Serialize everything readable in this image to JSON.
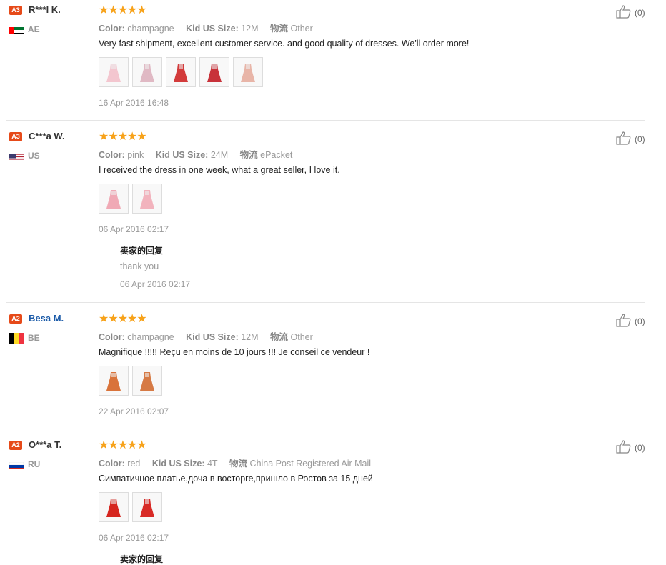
{
  "reviews": [
    {
      "level": "A3",
      "name": "R***l K.",
      "country": "AE",
      "flag": "ae",
      "name_link": false,
      "rating": "★★★★★",
      "color_label": "Color:",
      "color": "champagne",
      "size_label": "Kid US Size:",
      "size": "12M",
      "ship_label": "物流",
      "ship": "Other",
      "text": "Very fast shipment, excellent customer service. and good quality of dresses. We'll order more!",
      "photos": [
        "#f3c6cf",
        "#e0b9c4",
        "#d33b3b",
        "#c8323a",
        "#e8b5a8"
      ],
      "date": "16 Apr 2016 16:48",
      "likes": "(0)"
    },
    {
      "level": "A3",
      "name": "C***a W.",
      "country": "US",
      "flag": "us",
      "name_link": false,
      "rating": "★★★★★",
      "color_label": "Color:",
      "color": "pink",
      "size_label": "Kid US Size:",
      "size": "24M",
      "ship_label": "物流",
      "ship": "ePacket",
      "text": "I received the dress in one week, what a great seller, I love it.",
      "photos": [
        "#f0a9b5",
        "#f2b3bd"
      ],
      "date": "06 Apr 2016 02:17",
      "reply_title": "卖家的回复",
      "reply_text": "thank you",
      "reply_date": "06 Apr 2016 02:17",
      "likes": "(0)"
    },
    {
      "level": "A2",
      "name": "Besa M.",
      "country": "BE",
      "flag": "be",
      "name_link": true,
      "rating": "★★★★★",
      "color_label": "Color:",
      "color": "champagne",
      "size_label": "Kid US Size:",
      "size": "12M",
      "ship_label": "物流",
      "ship": "Other",
      "text": "Magnifique !!!!! Reçu en moins de 10 jours !!! Je conseil ce vendeur !",
      "photos": [
        "#d9733a",
        "#d67a45"
      ],
      "date": "22 Apr 2016 02:07",
      "likes": "(0)"
    },
    {
      "level": "A2",
      "name": "O***a T.",
      "country": "RU",
      "flag": "ru",
      "name_link": false,
      "rating": "★★★★★",
      "color_label": "Color:",
      "color": "red",
      "size_label": "Kid US Size:",
      "size": "4T",
      "ship_label": "物流",
      "ship": "China Post Registered Air Mail",
      "text": "Симпатичное платье,доча в восторге,пришло в Ростов за 15 дней",
      "photos": [
        "#d6261f",
        "#d82a26"
      ],
      "date": "06 Apr 2016 02:17",
      "reply_title": "卖家的回复",
      "likes": "(0)"
    }
  ]
}
